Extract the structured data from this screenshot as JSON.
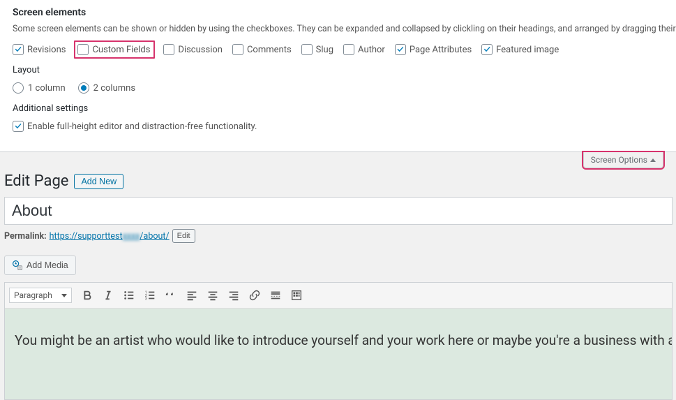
{
  "screen_options": {
    "heading": "Screen elements",
    "description": "Some screen elements can be shown or hidden by using the checkboxes. They can be expanded and collapsed by clickling on their headings, and arranged by dragging their headings or by clicking on the u",
    "boxes": [
      {
        "label": "Revisions",
        "checked": true,
        "highlight": false,
        "name": "revisions"
      },
      {
        "label": "Custom Fields",
        "checked": false,
        "highlight": true,
        "name": "custom-fields"
      },
      {
        "label": "Discussion",
        "checked": false,
        "highlight": false,
        "name": "discussion"
      },
      {
        "label": "Comments",
        "checked": false,
        "highlight": false,
        "name": "comments"
      },
      {
        "label": "Slug",
        "checked": false,
        "highlight": false,
        "name": "slug"
      },
      {
        "label": "Author",
        "checked": false,
        "highlight": false,
        "name": "author"
      },
      {
        "label": "Page Attributes",
        "checked": true,
        "highlight": false,
        "name": "page-attributes"
      },
      {
        "label": "Featured image",
        "checked": true,
        "highlight": false,
        "name": "featured-image"
      }
    ],
    "layout_heading": "Layout",
    "layout_options": [
      {
        "label": "1 column",
        "selected": false
      },
      {
        "label": "2 columns",
        "selected": true
      }
    ],
    "additional_heading": "Additional settings",
    "additional_option": {
      "label": "Enable full-height editor and distraction-free functionality.",
      "checked": true
    },
    "tab_label": "Screen Options"
  },
  "page": {
    "heading": "Edit Page",
    "add_new_label": "Add New",
    "title_value": "About",
    "permalink_label": "Permalink:",
    "permalink_url_visible": "https://supporttest",
    "permalink_url_blur": "xxxx",
    "permalink_url_suffix": "/about/",
    "edit_label": "Edit",
    "add_media_label": "Add Media",
    "format_select": "Paragraph",
    "content": "You might be an artist who would like to introduce yourself and your work here or maybe you're a business with a mission to describe."
  },
  "toolbar_icons": [
    "bold",
    "italic",
    "bullet-list",
    "number-list",
    "quote",
    "align-left",
    "align-center",
    "align-right",
    "link",
    "read-more",
    "toolbar-toggle"
  ]
}
